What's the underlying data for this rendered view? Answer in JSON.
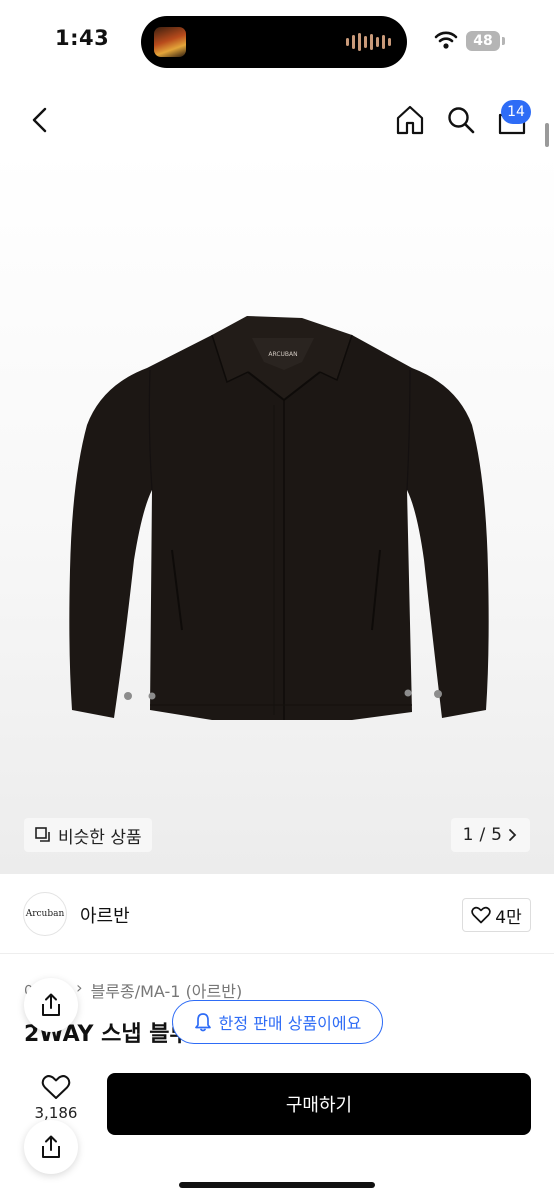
{
  "status_bar": {
    "time": "1:43",
    "battery": "48"
  },
  "nav": {
    "cart_count": "14"
  },
  "gallery": {
    "similar_label": "비슷한 상품",
    "current": "1",
    "separator": "/",
    "total": "5",
    "jacket_tag": "ARCUBAN"
  },
  "brand": {
    "logo_text": "Arcuban",
    "name": "아르반",
    "likes": "4만"
  },
  "product": {
    "breadcrumb": [
      "아우터",
      "블루종/MA-1 (아르반)"
    ],
    "title": "2WAY 스냅 블루종"
  },
  "toast": {
    "label": "한정 판매 상품이에요"
  },
  "bottom": {
    "wish_count": "3,186",
    "buy_label": "구매하기"
  },
  "colors": {
    "accent": "#2e6cf6",
    "buy_button": "#000000",
    "jacket": "#1c1714"
  },
  "icons": [
    "back-icon",
    "home-icon",
    "search-icon",
    "cart-icon",
    "copy-icon",
    "chevron-right-icon",
    "heart-icon",
    "bell-icon",
    "share-icon",
    "wifi-icon"
  ]
}
